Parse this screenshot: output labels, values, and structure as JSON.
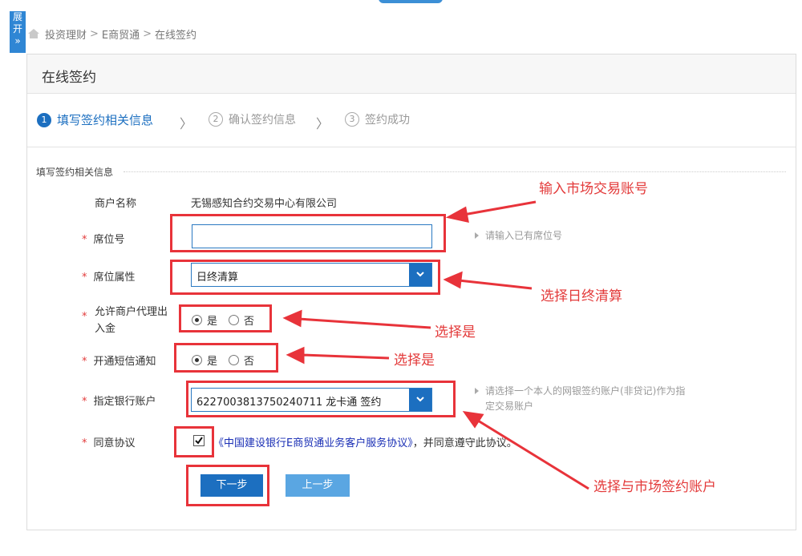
{
  "sidebar": {
    "expand_label_1": "展",
    "expand_label_2": "开",
    "expand_label_3": "»"
  },
  "breadcrumb": {
    "items": [
      "投资理财",
      "E商贸通",
      "在线签约"
    ],
    "sep": ">"
  },
  "panel": {
    "title": "在线签约"
  },
  "steps": [
    {
      "num": "1",
      "label": "填写签约相关信息",
      "active": true
    },
    {
      "num": "2",
      "label": "确认签约信息",
      "active": false
    },
    {
      "num": "3",
      "label": "签约成功",
      "active": false
    }
  ],
  "chevron": "〉",
  "form": {
    "section_title": "填写签约相关信息",
    "required_mark": "*",
    "merchant_name": {
      "label": "商户名称",
      "value": "无锡感知合约交易中心有限公司"
    },
    "seat_no": {
      "label": "席位号",
      "value": "",
      "hint": "请输入已有席位号"
    },
    "seat_attr": {
      "label": "席位属性",
      "value": "日终清算"
    },
    "allow_agent": {
      "label_1": "允许商户代理出",
      "label_2": "入金",
      "yes": "是",
      "no": "否",
      "selected": "yes"
    },
    "sms_notice": {
      "label": "开通短信通知",
      "yes": "是",
      "no": "否",
      "selected": "yes"
    },
    "bank_account": {
      "label": "指定银行账户",
      "value": "6227003813750240711 龙卡通 签约",
      "hint_1": "请选择一个本人的网银签约账户(非贷记)作为指",
      "hint_2": "定交易账户"
    },
    "agreement": {
      "label": "同意协议",
      "checked": true,
      "link_text": "《中国建设银行E商贸通业务客户服务协议》",
      "suffix": "，并同意遵守此协议。"
    },
    "next_button": "下一步",
    "prev_button": "上一步"
  },
  "annotations": {
    "a1": "输入市场交易账号",
    "a2": "选择日终清算",
    "a3": "选择是",
    "a4": "选择是",
    "a5": "选择与市场签约账户"
  },
  "colors": {
    "primary": "#1c6fc0",
    "annotation": "#e8333a",
    "link": "#1a2fb5"
  }
}
